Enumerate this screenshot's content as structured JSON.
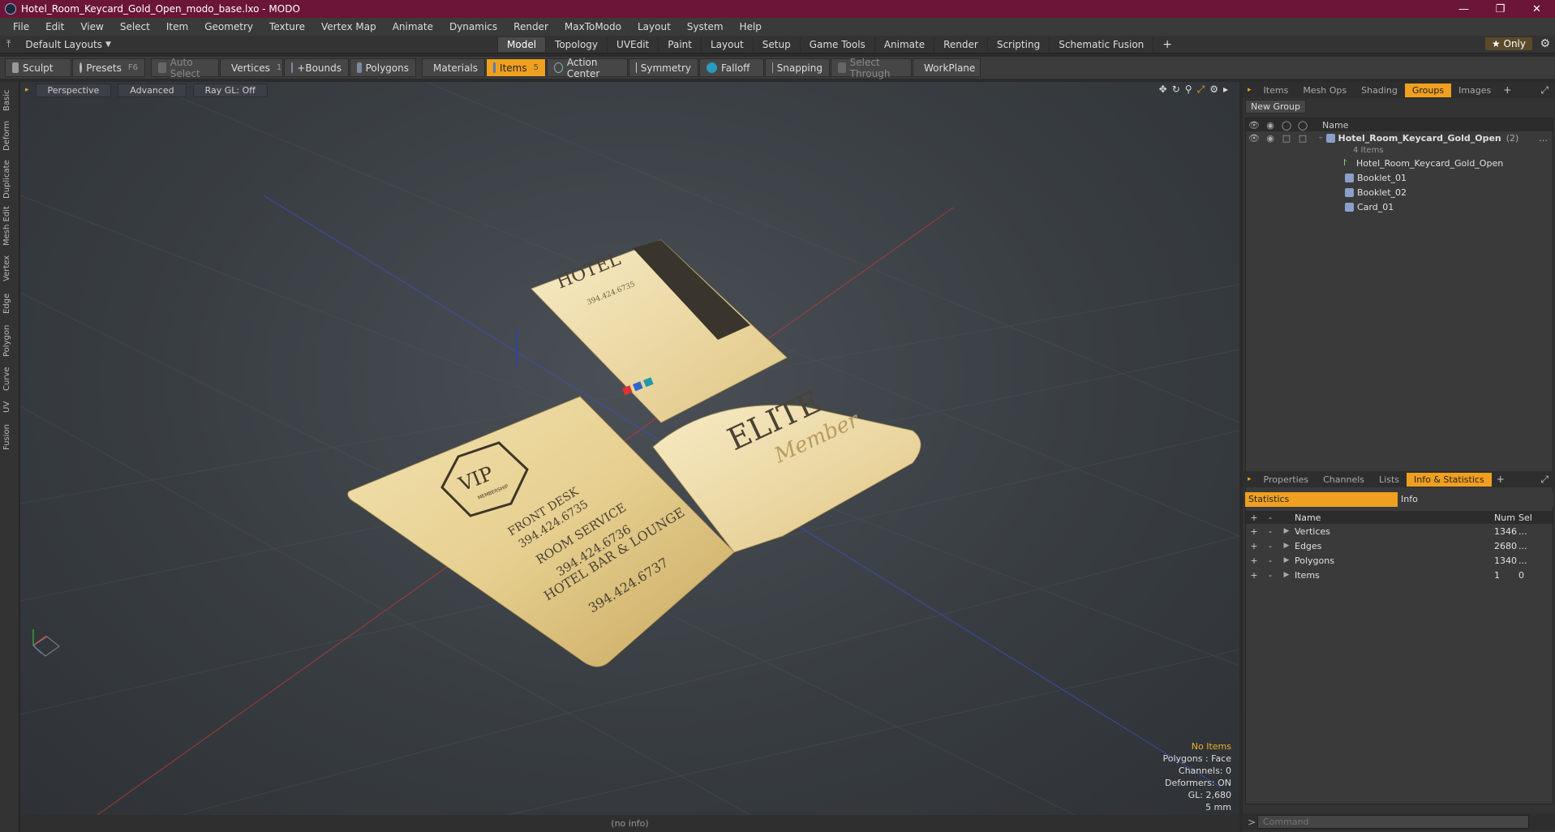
{
  "window": {
    "title": "Hotel_Room_Keycard_Gold_Open_modo_base.lxo - MODO",
    "controls": [
      "—",
      "❐",
      "✕"
    ]
  },
  "menus": [
    "File",
    "Edit",
    "View",
    "Select",
    "Item",
    "Geometry",
    "Texture",
    "Vertex Map",
    "Animate",
    "Dynamics",
    "Render",
    "MaxToModo",
    "Layout",
    "System",
    "Help"
  ],
  "layout_bar": {
    "layout_selector": "Default Layouts",
    "tabs": [
      "Model",
      "Topology",
      "UVEdit",
      "Paint",
      "Layout",
      "Setup",
      "Game Tools",
      "Animate",
      "Render",
      "Scripting",
      "Schematic Fusion"
    ],
    "active_tab": "Model",
    "only_label": "Only"
  },
  "toolbar": {
    "sculpt": "Sculpt",
    "presets": "Presets",
    "presets_key": "F6",
    "auto_select": "Auto Select",
    "vertices": "Vertices",
    "vertices_count": "1",
    "bounds": "+Bounds",
    "polygons": "Polygons",
    "materials": "Materials",
    "items": "Items",
    "items_count": "5",
    "action_center": "Action Center",
    "symmetry": "Symmetry",
    "falloff": "Falloff",
    "snapping": "Snapping",
    "select_through": "Select Through",
    "workplane": "WorkPlane"
  },
  "left_tabs": [
    "Basic",
    "Deform",
    "Duplicate",
    "Mesh Edit",
    "Vertex",
    "Edge",
    "Polygon",
    "Curve",
    "UV",
    "Fusion"
  ],
  "viewport": {
    "view": "Perspective",
    "shading": "Advanced",
    "raygl": "Ray GL: Off",
    "stats": {
      "selection": "No Items",
      "polygons": "Polygons : Face",
      "channels": "Channels: 0",
      "deformers": "Deformers: ON",
      "gl": "GL: 2,680",
      "scale": "5 mm"
    },
    "status": "(no info)",
    "scene_text": {
      "hotel": "HOTEL",
      "hotel_phone": "394.424.6735",
      "vip": "VIP",
      "membership": "MEMBERSHIP",
      "front_desk": "FRONT DESK",
      "front_desk_phone": "394.424.6735",
      "room_service": "ROOM SERVICE",
      "room_service_phone": "394.424.6736",
      "bar": "HOTEL BAR & LOUNGE",
      "bar_phone": "394.424.6737",
      "elite": "ELITE",
      "member": "Member"
    }
  },
  "top_panel": {
    "tabs": [
      "Items",
      "Mesh Ops",
      "Shading",
      "Groups",
      "Images"
    ],
    "active_tab": "Groups",
    "new_group": "New Group",
    "name_header": "Name",
    "group_name": "Hotel_Room_Keycard_Gold_Open",
    "group_count": "(2)",
    "group_sub": "4 Items",
    "children": [
      "Hotel_Room_Keycard_Gold_Open",
      "Booklet_01",
      "Booklet_02",
      "Card_01"
    ]
  },
  "bottom_panel": {
    "tabs": [
      "Properties",
      "Channels",
      "Lists",
      "Info & Statistics"
    ],
    "active_tab": "Info & Statistics",
    "subtabs": [
      "Statistics",
      "Info"
    ],
    "headers": {
      "name": "Name",
      "num": "Num",
      "sel": "Sel"
    },
    "rows": [
      {
        "name": "Vertices",
        "num": "1346",
        "sel": "..."
      },
      {
        "name": "Edges",
        "num": "2680",
        "sel": "..."
      },
      {
        "name": "Polygons",
        "num": "1340",
        "sel": "..."
      },
      {
        "name": "Items",
        "num": "1",
        "sel": "0"
      }
    ],
    "command_placeholder": "Command"
  }
}
